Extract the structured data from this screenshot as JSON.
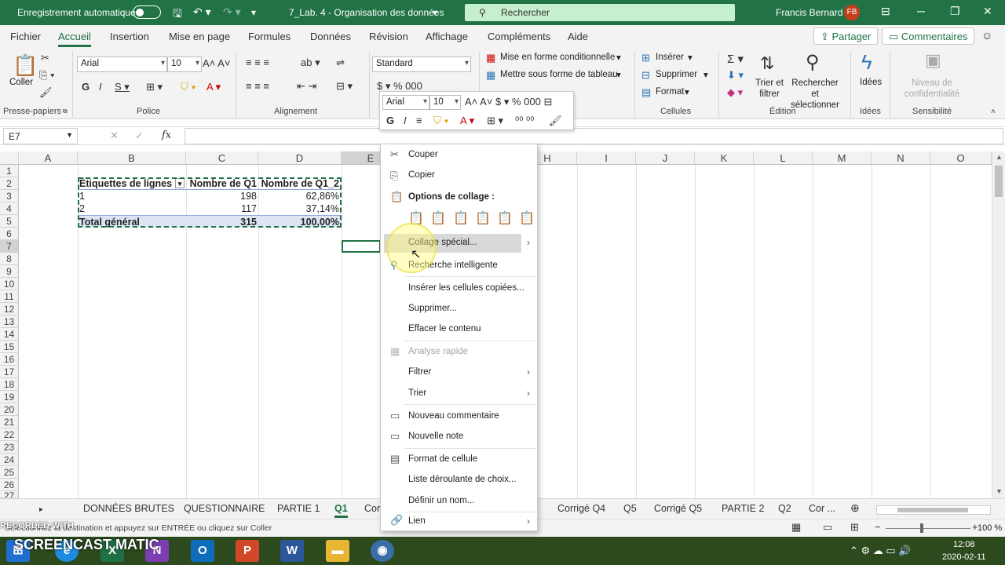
{
  "titlebar": {
    "autosave": "Enregistrement automatique",
    "filename": "7_Lab. 4 - Organisation des données",
    "search": "Rechercher",
    "user": "Francis Bernard",
    "initials": "FB"
  },
  "tabs": [
    "Fichier",
    "Accueil",
    "Insertion",
    "Mise en page",
    "Formules",
    "Données",
    "Révision",
    "Affichage",
    "Compléments",
    "Aide"
  ],
  "share_label": "Partager",
  "comments_label": "Commentaires",
  "ribbon": {
    "paste_label": "Coller",
    "clipboard_group": "Presse-papiers",
    "font_name": "Arial",
    "font_size": "10",
    "font_group": "Police",
    "alignment_group": "Alignement",
    "number_format": "Standard",
    "cond_format": "Mise en forme conditionnelle",
    "table_format": "Mettre sous forme de tableau",
    "insert": "Insérer",
    "delete": "Supprimer",
    "format": "Format",
    "cells_group": "Cellules",
    "sort_filter": "Trier et filtrer",
    "find_select": "Rechercher et sélectionner",
    "edition_group": "Édition",
    "ideas": "Idées",
    "ideas_group": "Idées",
    "sensitivity": "Niveau de confidentialité",
    "sensitivity_group": "Sensibilité"
  },
  "formula_bar": {
    "namebox": "E7",
    "fx": "fx",
    "value": ""
  },
  "columns": [
    "A",
    "B",
    "C",
    "D",
    "E",
    "F",
    "G",
    "H",
    "I",
    "J",
    "K",
    "L",
    "M",
    "N",
    "O"
  ],
  "rows": [
    "1",
    "2",
    "3",
    "4",
    "5",
    "6",
    "7",
    "8",
    "9",
    "10",
    "11",
    "12",
    "13",
    "14",
    "15",
    "16",
    "17",
    "18",
    "19",
    "20",
    "21",
    "22",
    "23",
    "24",
    "25",
    "26",
    "27"
  ],
  "pivot": {
    "header": [
      "Étiquettes de lignes",
      "Nombre de Q1",
      "Nombre de Q1_2"
    ],
    "rows": [
      [
        "1",
        "198",
        "62,86%"
      ],
      [
        "2",
        "117",
        "37,14%"
      ]
    ],
    "total": [
      "Total général",
      "315",
      "100,00%"
    ]
  },
  "minitoolbar": {
    "font": "Arial",
    "size": "10"
  },
  "context_menu": {
    "cut": "Couper",
    "copy": "Copier",
    "paste_options": "Options de collage :",
    "paste_special": "Collage spécial...",
    "smart_lookup": "Recherche intelligente",
    "insert_copied": "Insérer les cellules copiées...",
    "delete": "Supprimer...",
    "clear": "Effacer le contenu",
    "quick_analysis": "Analyse rapide",
    "filter": "Filtrer",
    "sort": "Trier",
    "new_comment": "Nouveau commentaire",
    "new_note": "Nouvelle note",
    "format_cells": "Format de cellule",
    "dropdown_list": "Liste déroulante de choix...",
    "define_name": "Définir un nom...",
    "link": "Lien"
  },
  "sheet_tabs": [
    "DONNÉES BRUTES",
    "QUESTIONNAIRE",
    "PARTIE 1",
    "Q1",
    "Cor",
    "Corrigé Q4",
    "Q5",
    "Corrigé Q5",
    "PARTIE 2",
    "Q2",
    "Cor ..."
  ],
  "status": {
    "message": "Sélectionnez la destination et appuyez sur ENTRÉE ou cliquez sur Coller",
    "zoom": "100 %"
  },
  "watermark": {
    "line1": "RECORDED WITH",
    "line2": "SCREENCAST MATIC"
  },
  "taskbar": {
    "time": "12:08",
    "date": "2020-02-11"
  }
}
